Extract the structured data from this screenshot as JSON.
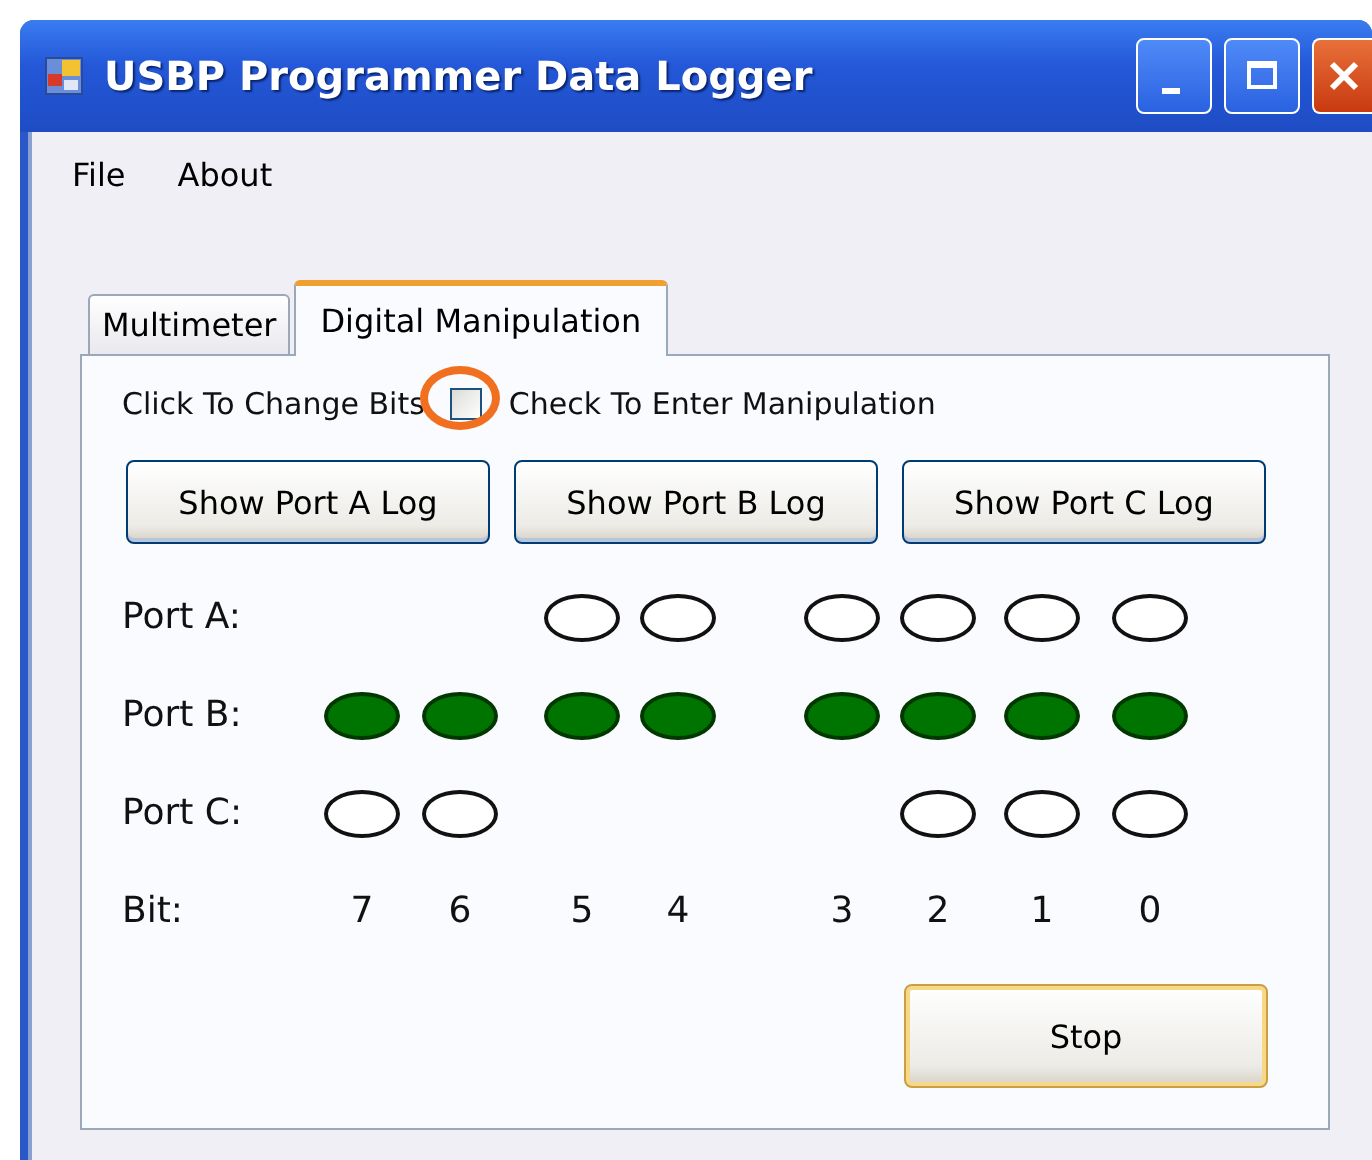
{
  "window": {
    "title": "USBP Programmer Data Logger"
  },
  "menu": [
    "File",
    "About"
  ],
  "tabs": [
    {
      "label": "Multimeter",
      "selected": false
    },
    {
      "label": "Digital Manipulation",
      "selected": true
    }
  ],
  "manipulation": {
    "label": "Click To Change Bits",
    "checkbox_label": "Check To Enter Manipulation",
    "checked": false,
    "highlighted": true
  },
  "log_buttons": [
    "Show Port A Log",
    "Show Port B Log",
    "Show Port C Log"
  ],
  "ports": [
    {
      "label": "Port A:",
      "leds": [
        {
          "kind": "empty"
        },
        {
          "kind": "empty"
        },
        {
          "kind": "led",
          "on": false
        },
        {
          "kind": "led",
          "on": false
        },
        {
          "kind": "led",
          "on": false
        },
        {
          "kind": "led",
          "on": false
        },
        {
          "kind": "led",
          "on": false
        },
        {
          "kind": "led",
          "on": false
        }
      ]
    },
    {
      "label": "Port B:",
      "leds": [
        {
          "kind": "led",
          "on": true
        },
        {
          "kind": "led",
          "on": true
        },
        {
          "kind": "led",
          "on": true
        },
        {
          "kind": "led",
          "on": true
        },
        {
          "kind": "led",
          "on": true
        },
        {
          "kind": "led",
          "on": true
        },
        {
          "kind": "led",
          "on": true
        },
        {
          "kind": "led",
          "on": true
        }
      ]
    },
    {
      "label": "Port C:",
      "leds": [
        {
          "kind": "led",
          "on": false
        },
        {
          "kind": "led",
          "on": false
        },
        {
          "kind": "empty"
        },
        {
          "kind": "empty"
        },
        {
          "kind": "empty"
        },
        {
          "kind": "led",
          "on": false
        },
        {
          "kind": "led",
          "on": false
        },
        {
          "kind": "led",
          "on": false
        }
      ]
    }
  ],
  "bits": {
    "label": "Bit:",
    "values": [
      "7",
      "6",
      "5",
      "4",
      "3",
      "2",
      "1",
      "0"
    ]
  },
  "stop_button": "Stop"
}
